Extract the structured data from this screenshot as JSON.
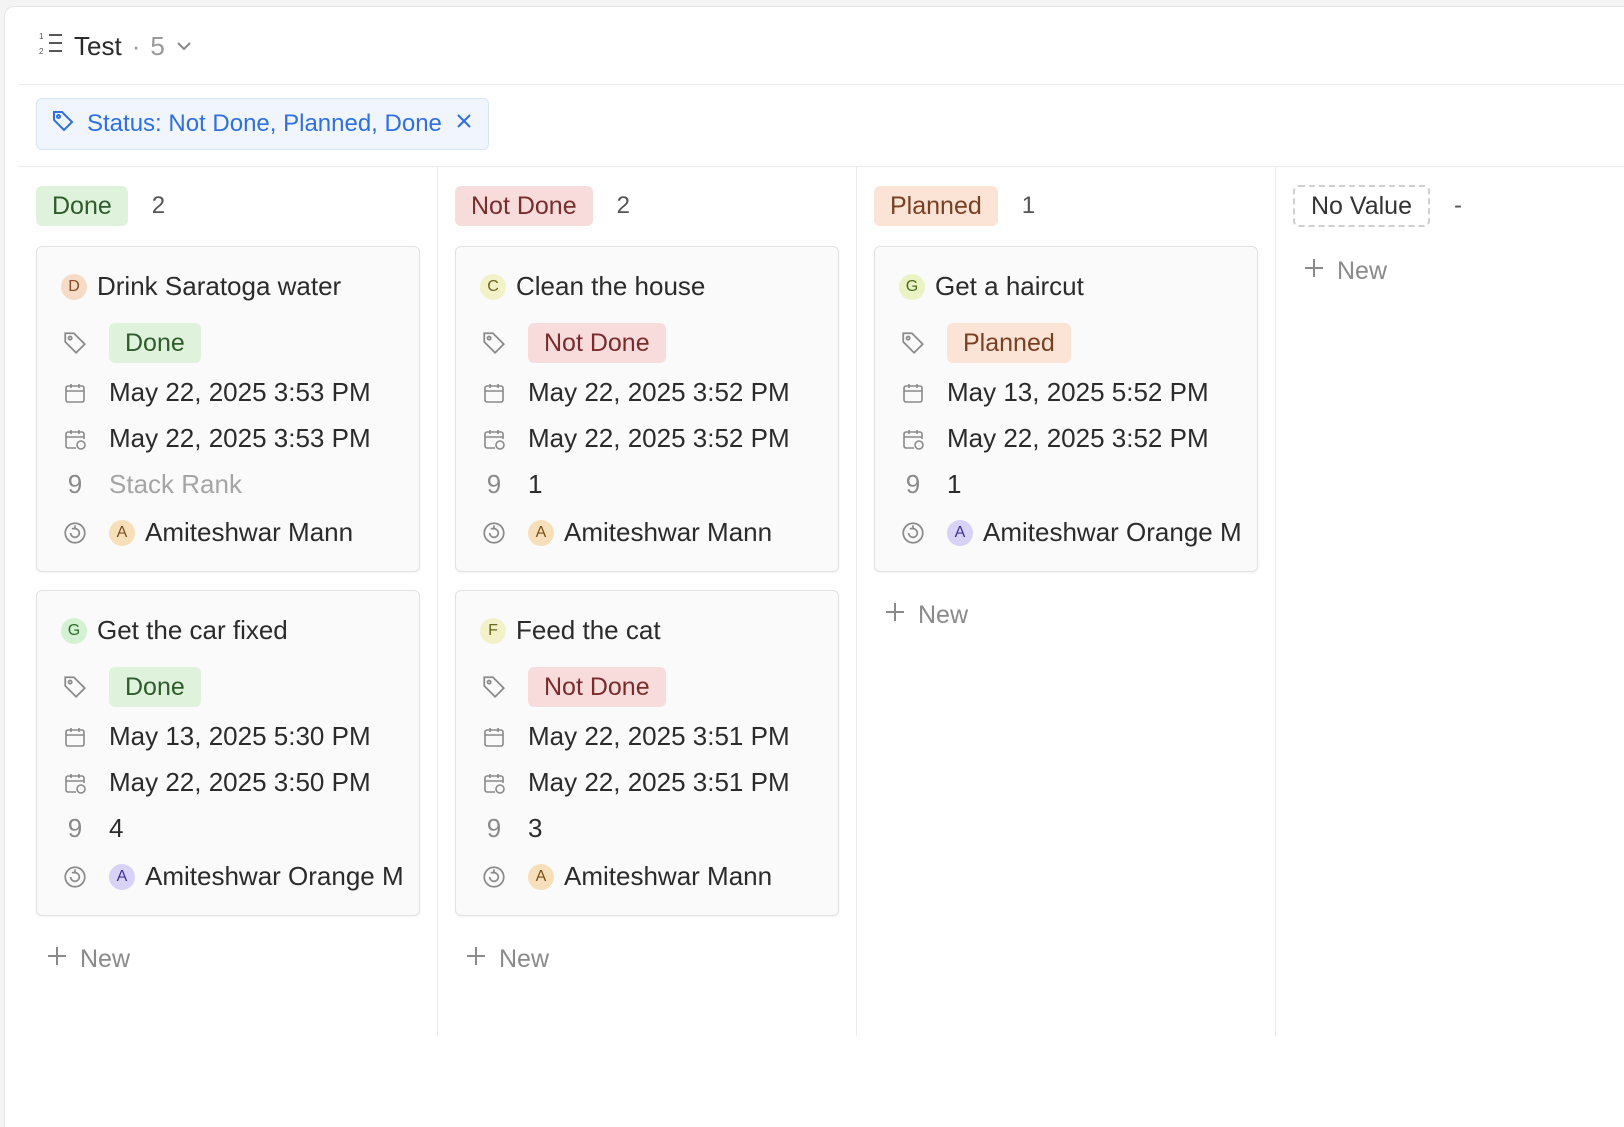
{
  "header": {
    "title": "Test",
    "separator": "·",
    "count": "5"
  },
  "filter": {
    "label": "Status: Not Done, Planned, Done"
  },
  "columns": [
    {
      "label": "Done",
      "count": "2",
      "cards": [
        {
          "letter": "D",
          "title": "Drink Saratoga water",
          "status": "Done",
          "date1": "May 22, 2025 3:53 PM",
          "date2": "May 22, 2025 3:53 PM",
          "rank": "Stack Rank",
          "assignee_letter": "A",
          "assignee": "Amiteshwar Mann"
        },
        {
          "letter": "G",
          "title": "Get the car fixed",
          "status": "Done",
          "date1": "May 13, 2025 5:30 PM",
          "date2": "May 22, 2025 3:50 PM",
          "rank": "4",
          "assignee_letter": "A",
          "assignee": "Amiteshwar Orange M"
        }
      ],
      "new_label": "New"
    },
    {
      "label": "Not Done",
      "count": "2",
      "cards": [
        {
          "letter": "C",
          "title": "Clean the house",
          "status": "Not Done",
          "date1": "May 22, 2025 3:52 PM",
          "date2": "May 22, 2025 3:52 PM",
          "rank": "1",
          "assignee_letter": "A",
          "assignee": "Amiteshwar Mann"
        },
        {
          "letter": "F",
          "title": "Feed the cat",
          "status": "Not Done",
          "date1": "May 22, 2025 3:51 PM",
          "date2": "May 22, 2025 3:51 PM",
          "rank": "3",
          "assignee_letter": "A",
          "assignee": "Amiteshwar Mann"
        }
      ],
      "new_label": "New"
    },
    {
      "label": "Planned",
      "count": "1",
      "cards": [
        {
          "letter": "G",
          "title": "Get a haircut",
          "status": "Planned",
          "date1": "May 13, 2025 5:52 PM",
          "date2": "May 22, 2025 3:52 PM",
          "rank": "1",
          "assignee_letter": "A",
          "assignee": "Amiteshwar Orange M"
        }
      ],
      "new_label": "New"
    },
    {
      "label": "No Value",
      "count": "-",
      "new_label": "New"
    }
  ],
  "rank_icon": "9",
  "colors": {
    "done": "#dff3dc",
    "not_done": "#f8dcdc",
    "planned": "#fbe3d6",
    "accent": "#2f6fe0"
  },
  "icons": [
    "list-icon",
    "chevron-down-icon",
    "tag-icon",
    "close-icon",
    "calendar-icon",
    "calendar-clock-icon",
    "number-icon",
    "user-cycle-icon",
    "plus-icon"
  ]
}
